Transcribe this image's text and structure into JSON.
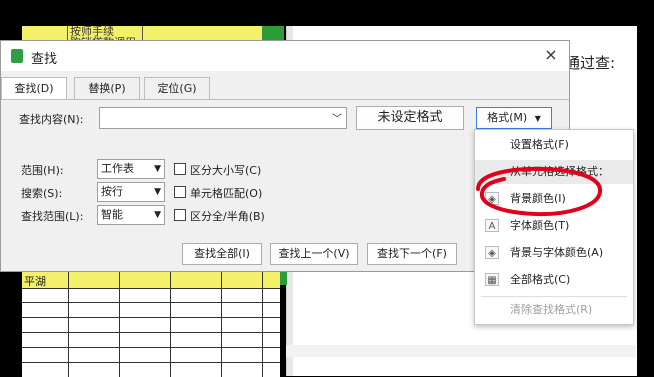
{
  "background_sheet": {
    "top_cell_lines": [
      "按师手续",
      "购销贷款调用"
    ],
    "bottom_cell_text": "平湖",
    "right_panel_text": "通过查:"
  },
  "dialog": {
    "title": "查找",
    "close_symbol": "×",
    "tabs": [
      {
        "label": "查找(D)",
        "active": true
      },
      {
        "label": "替换(P)",
        "active": false
      },
      {
        "label": "定位(G)",
        "active": false
      }
    ],
    "find_label": "查找内容(N):",
    "find_value": "",
    "format_status": "未设定格式",
    "format_button": "格式(M)",
    "options": {
      "scope_label": "范围(H):",
      "scope_value": "工作表",
      "search_label": "搜索(S):",
      "search_value": "按行",
      "lookin_label": "查找范围(L):",
      "lookin_value": "智能",
      "match_case": "区分大小写(C)",
      "match_cell": "单元格匹配(O)",
      "match_width": "区分全/半角(B)"
    },
    "buttons": {
      "find_all": "查找全部(I)",
      "find_prev": "查找上一个(V)",
      "find_next": "查找下一个(F)"
    }
  },
  "format_menu": {
    "items": [
      {
        "label": "设置格式(F)",
        "icon": "none",
        "state": "normal"
      },
      {
        "label": "从单元格选择格式：",
        "icon": "none",
        "state": "header"
      },
      {
        "label": "背景颜色(I)",
        "icon": "fill-icon",
        "state": "normal"
      },
      {
        "label": "字体颜色(T)",
        "icon": "font-color-icon",
        "state": "normal"
      },
      {
        "label": "背景与字体颜色(A)",
        "icon": "fill-font-icon",
        "state": "normal"
      },
      {
        "label": "全部格式(C)",
        "icon": "format-icon",
        "state": "normal"
      },
      {
        "label": "清除查找格式(R)",
        "icon": "none",
        "state": "disabled"
      }
    ]
  },
  "colors": {
    "sheet_yellow": "#f5f06a",
    "sheet_green": "#2e9b39",
    "annotation_red": "#e0001a",
    "accent_blue": "#3b7ddd"
  }
}
